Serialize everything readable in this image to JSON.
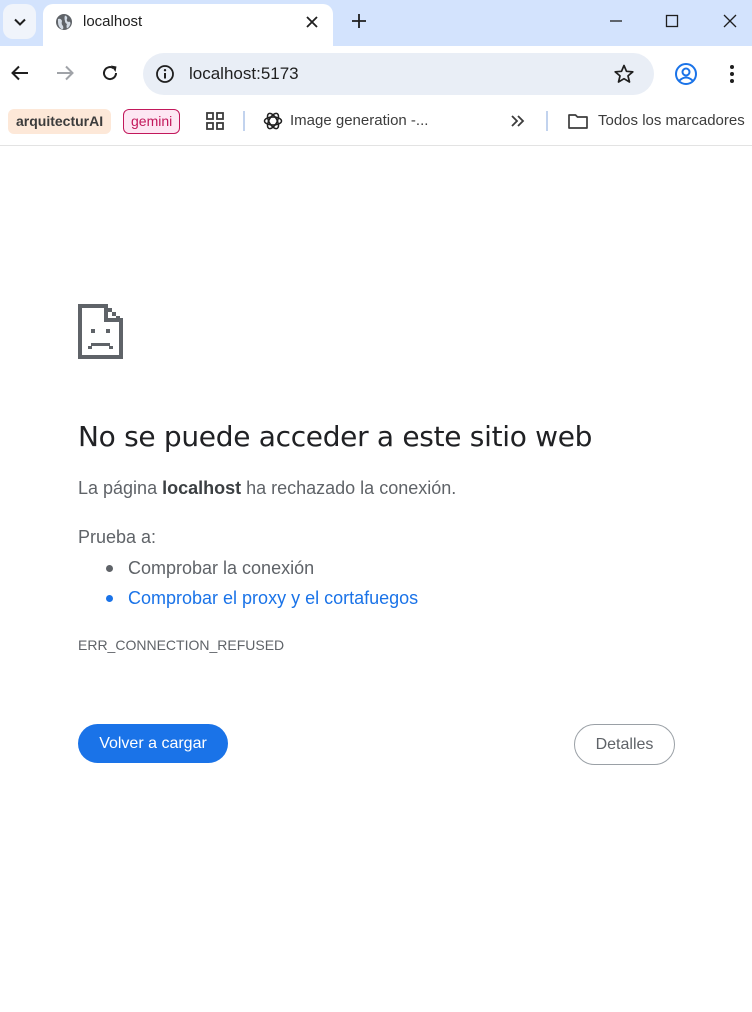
{
  "browser": {
    "tab": {
      "title": "localhost",
      "favicon": "globe-icon"
    },
    "omnibox": {
      "url": "localhost:5173"
    },
    "bookmarks": {
      "chip1": "arquitecturAI",
      "chip2": "gemini",
      "image_generation": "Image generation -...",
      "all_bookmarks": "Todos los marcadores"
    }
  },
  "error": {
    "title": "No se puede acceder a este sitio web",
    "desc_prefix": "La página ",
    "desc_host": "localhost",
    "desc_suffix": " ha rechazado la conexión.",
    "try_label": "Prueba a:",
    "suggestions": [
      {
        "text": "Comprobar la conexión",
        "link": false
      },
      {
        "text": "Comprobar el proxy y el cortafuegos",
        "link": true
      }
    ],
    "code": "ERR_CONNECTION_REFUSED"
  },
  "buttons": {
    "reload": "Volver a cargar",
    "details": "Detalles"
  },
  "colors": {
    "tabstrip_bg": "#d3e3fd",
    "primary_blue": "#1a73e8",
    "gemini_pink": "#c2185b"
  }
}
